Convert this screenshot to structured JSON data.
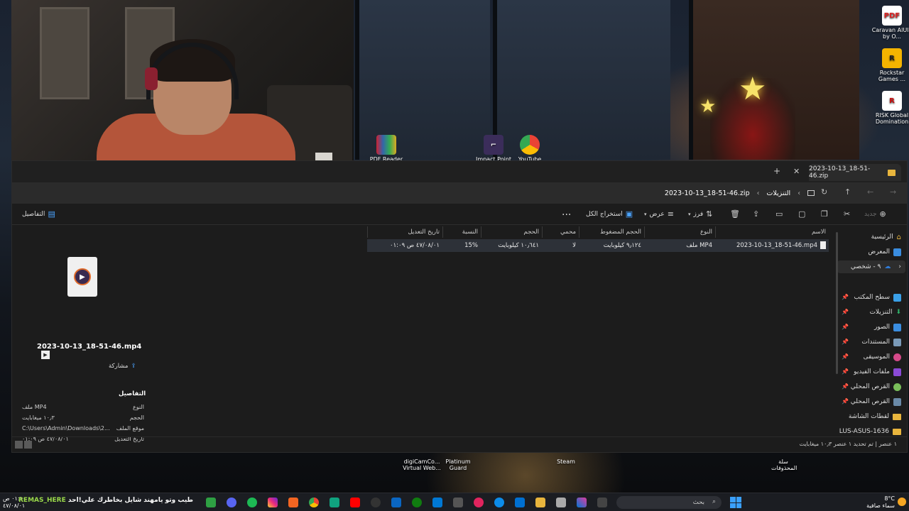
{
  "desktop": {
    "icons_right": [
      {
        "label": "Caravan AlUla by O...",
        "icon": "pdf-icon",
        "badge": "PDF"
      },
      {
        "label": "Rockstar Games ...",
        "icon": "rockstar-icon",
        "badge": "R"
      },
      {
        "label": "RISK Global Domination",
        "icon": "risk-icon",
        "badge": "R"
      }
    ],
    "icons_top": [
      {
        "label": "PDF Reader",
        "icon": "winrar-icon"
      },
      {
        "label": "Impact Point",
        "icon": "impact-point-icon"
      },
      {
        "label": "YouTube",
        "icon": "chrome-icon"
      }
    ],
    "icons_bottom": [
      {
        "label": "digiCamCo... Virtual Web...",
        "icon": "webcam-app-icon"
      },
      {
        "label": "Platinum Guard",
        "icon": "platinum-guard-icon"
      },
      {
        "label": "Steam",
        "icon": "steam-icon"
      },
      {
        "label": "سلة المحذوفات",
        "icon": "recycle-bin-icon"
      }
    ]
  },
  "explorer": {
    "tab_title": "2023-10-13_18-51-46.zip",
    "breadcrumb": [
      "التنزيلات",
      "2023-10-13_18-51-46.zip"
    ],
    "commands": {
      "new": "جديد",
      "sort": "فرز",
      "view": "عرض",
      "extract_all": "استخراج الكل",
      "more": "...",
      "details": "التفاصيل"
    },
    "sidebar": {
      "items": [
        {
          "label": "الرئيسية",
          "icon": "home-icon",
          "color": "#e8b53d"
        },
        {
          "label": "المعرض",
          "icon": "gallery-icon",
          "color": "#3a8de0"
        },
        {
          "label": "٩ - شخصي",
          "icon": "onedrive-icon",
          "color": "#2f7ad6"
        },
        {
          "label": "سطح المكتب",
          "icon": "desktop-icon",
          "color": "#3aa0e8"
        },
        {
          "label": "التنزيلات",
          "icon": "downloads-icon",
          "color": "#2fb36a"
        },
        {
          "label": "الصور",
          "icon": "pictures-icon",
          "color": "#3a8de0"
        },
        {
          "label": "المستندات",
          "icon": "documents-icon",
          "color": "#7a9ab8"
        },
        {
          "label": "الموسيقى",
          "icon": "music-icon",
          "color": "#d64a8a"
        },
        {
          "label": "ملفات الفيديو",
          "icon": "videos-icon",
          "color": "#8a4ad6"
        },
        {
          "label": "القرص المحلي",
          "icon": "drive-icon",
          "color": "#7abf5a"
        },
        {
          "label": "القرص المحلي",
          "icon": "drive-icon",
          "color": "#6a8aa8"
        },
        {
          "label": "لقطات الشاشة",
          "icon": "folder-icon",
          "color": "#e8b53d"
        },
        {
          "label": "LUS-ASUS-1636",
          "icon": "folder-icon",
          "color": "#e8b53d"
        }
      ]
    },
    "columns": [
      "الاسم",
      "النوع",
      "الحجم المضغوط",
      "محمي بكلمة...",
      "الحجم",
      "النسبة",
      "تاريخ التعديل"
    ],
    "rows": [
      {
        "name": "2023-10-13_18-51-46.mp4",
        "type": "ملف MP4",
        "compressed": "٩٫١٢٤ كيلوبايت",
        "protected": "لا",
        "size": "١٠٫٦٤١ كيلوبايت",
        "ratio": "15%",
        "modified": "٤٧/٠٨/٠١ ص ٠١:٠٩"
      }
    ],
    "details_pane": {
      "file_name": "2023-10-13_18-51-46.mp4",
      "share": "مشاركة",
      "header": "التفاصيل",
      "props": [
        {
          "label": "النوع",
          "value": "ملف MP4"
        },
        {
          "label": "الحجم",
          "value": "١٠٫٣ ميغابايت"
        },
        {
          "label": "موقع الملف",
          "value": "C:\\Users\\Admin\\Downloads\\2..."
        },
        {
          "label": "تاريخ التعديل",
          "value": "٤٧/٠٨/٠١ ص ٠١:٠٩"
        }
      ]
    },
    "status": "١ عنصر  |  تم تحديد ١ عنصر ١٠٫٣ ميغابايت"
  },
  "taskbar": {
    "search_placeholder": "بحث",
    "weather_temp": "8°C",
    "weather_desc": "سماء صافية",
    "clock_time": "٠١:١٠ ص",
    "clock_date": "٤٧/٠٨/٠١",
    "marquee_user": "REMAS_HERE",
    "marquee_text": "طيب وتو يامهند شايل بخاطرك علي!احد"
  }
}
